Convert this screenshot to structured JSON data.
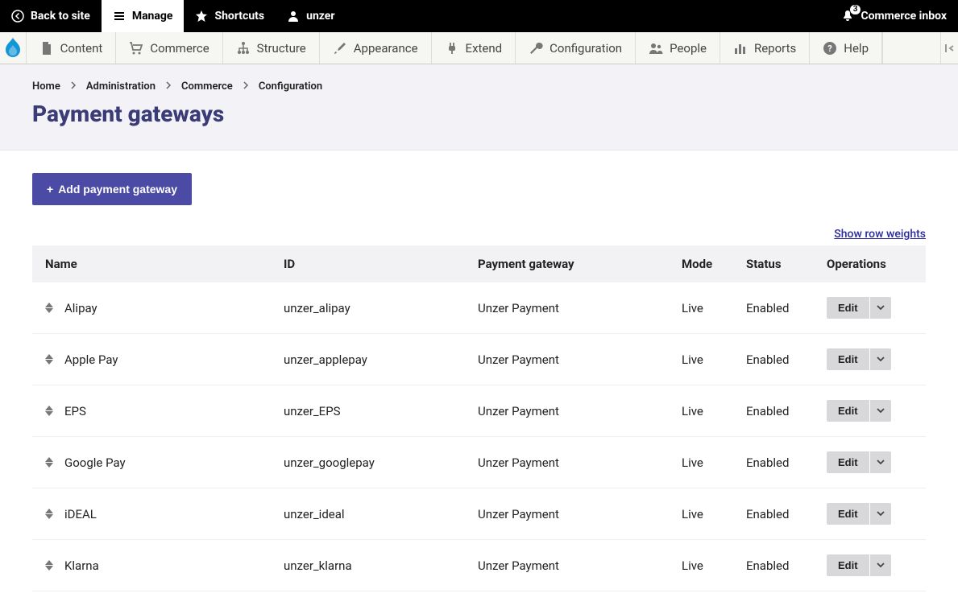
{
  "toolbar": {
    "back": "Back to site",
    "manage": "Manage",
    "shortcuts": "Shortcuts",
    "user": "unzer",
    "inbox_label": "Commerce inbox",
    "inbox_count": "3"
  },
  "admin_menu": {
    "items": [
      {
        "label": "Content",
        "icon": "file"
      },
      {
        "label": "Commerce",
        "icon": "cart"
      },
      {
        "label": "Structure",
        "icon": "tree"
      },
      {
        "label": "Appearance",
        "icon": "brush"
      },
      {
        "label": "Extend",
        "icon": "plug"
      },
      {
        "label": "Configuration",
        "icon": "wrench"
      },
      {
        "label": "People",
        "icon": "people"
      },
      {
        "label": "Reports",
        "icon": "bar"
      },
      {
        "label": "Help",
        "icon": "help"
      }
    ]
  },
  "breadcrumb": [
    "Home",
    "Administration",
    "Commerce",
    "Configuration"
  ],
  "page": {
    "title": "Payment gateways"
  },
  "buttons": {
    "add": "Add payment gateway",
    "show_weights": "Show row weights"
  },
  "table": {
    "headers": {
      "name": "Name",
      "id": "ID",
      "gateway": "Payment gateway",
      "mode": "Mode",
      "status": "Status",
      "ops": "Operations"
    },
    "edit_label": "Edit",
    "rows": [
      {
        "name": "Alipay",
        "id": "unzer_alipay",
        "gateway": "Unzer Payment",
        "mode": "Live",
        "status": "Enabled"
      },
      {
        "name": "Apple Pay",
        "id": "unzer_applepay",
        "gateway": "Unzer Payment",
        "mode": "Live",
        "status": "Enabled"
      },
      {
        "name": "EPS",
        "id": "unzer_EPS",
        "gateway": "Unzer Payment",
        "mode": "Live",
        "status": "Enabled"
      },
      {
        "name": "Google Pay",
        "id": "unzer_googlepay",
        "gateway": "Unzer Payment",
        "mode": "Live",
        "status": "Enabled"
      },
      {
        "name": "iDEAL",
        "id": "unzer_ideal",
        "gateway": "Unzer Payment",
        "mode": "Live",
        "status": "Enabled"
      },
      {
        "name": "Klarna",
        "id": "unzer_klarna",
        "gateway": "Unzer Payment",
        "mode": "Live",
        "status": "Enabled"
      }
    ]
  }
}
